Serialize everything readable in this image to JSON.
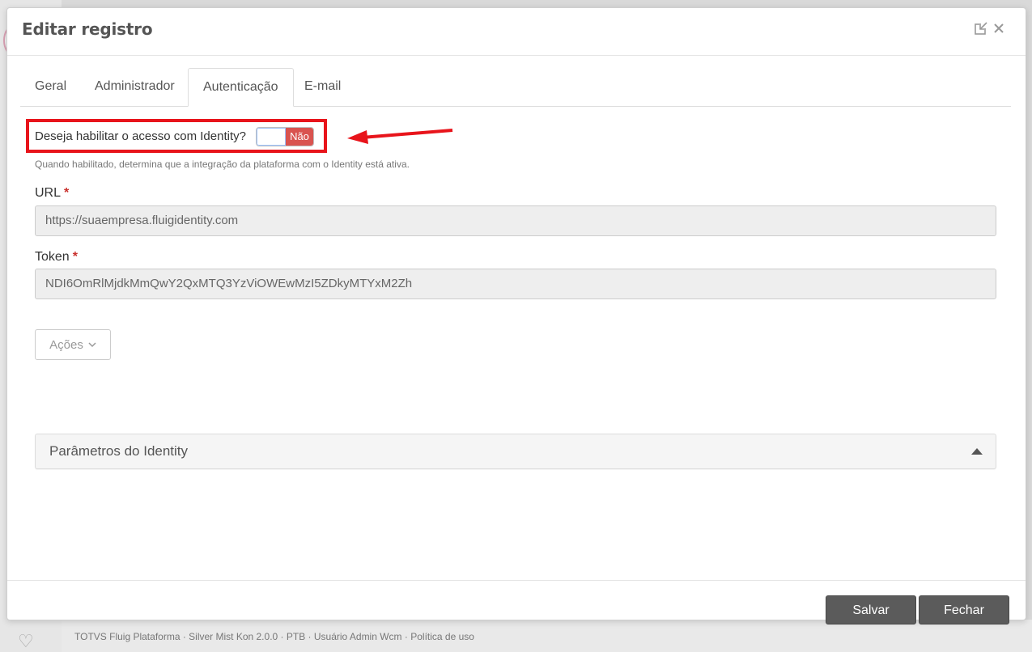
{
  "background": {
    "footer_text": "TOTVS Fluig Plataforma · Silver Mist Kon 2.0.0 · PTB · Usuário Admin Wcm · Política de uso"
  },
  "modal": {
    "title": "Editar registro",
    "header_icons": [
      "minimize-icon",
      "close-icon"
    ],
    "tabs": [
      {
        "label": "Geral",
        "active": false
      },
      {
        "label": "Administrador",
        "active": false
      },
      {
        "label": "Autenticação",
        "active": true
      },
      {
        "label": "E-mail",
        "active": false
      }
    ],
    "identity_toggle": {
      "question": "Deseja habilitar o acesso com Identity?",
      "state_label": "Não",
      "enabled": false,
      "help": "Quando habilitado, determina que a integração da plataforma com o Identity está ativa."
    },
    "url_field": {
      "label": "URL",
      "required_mark": "*",
      "value": "https://suaempresa.fluigidentity.com"
    },
    "token_field": {
      "label": "Token",
      "required_mark": "*",
      "value": "NDI6OmRlMjdkMmQwY2QxMTQ3YzViOWEwMzI5ZDkyMTYxM2Zh"
    },
    "actions_button": {
      "label": "Ações"
    },
    "identity_params_panel": {
      "title": "Parâmetros do Identity"
    },
    "footer": {
      "save_label": "Salvar",
      "close_label": "Fechar"
    }
  },
  "annotation": {
    "highlight_color": "#e8141b"
  },
  "colors": {
    "toggle_off": "#d9534f",
    "footer_button": "#5b5b5b"
  }
}
